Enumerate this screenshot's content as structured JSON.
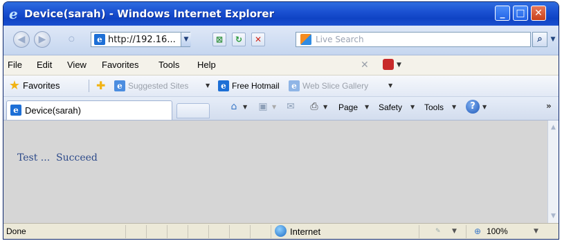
{
  "window": {
    "title": "Device(sarah) - Windows Internet Explorer"
  },
  "address": {
    "url": "http://192.16..."
  },
  "search": {
    "placeholder": "Live Search"
  },
  "menu": [
    "File",
    "Edit",
    "View",
    "Favorites",
    "Tools",
    "Help"
  ],
  "favorites": {
    "label": "Favorites",
    "links": [
      {
        "label": "Suggested Sites",
        "style": "dim"
      },
      {
        "label": "Free Hotmail",
        "style": "dark"
      },
      {
        "label": "Web Slice Gallery",
        "style": "dim"
      }
    ]
  },
  "tab": {
    "label": "Device(sarah)"
  },
  "commands": {
    "page": "Page",
    "safety": "Safety",
    "tools": "Tools"
  },
  "content": {
    "text": "Test ...  Succeed"
  },
  "status": {
    "text": "Done",
    "zone": "Internet",
    "zoom": "100%"
  },
  "colors": {
    "titlebar": "#1b51d2",
    "content_bg": "#d6d6d6",
    "content_text": "#2d4a8a"
  }
}
